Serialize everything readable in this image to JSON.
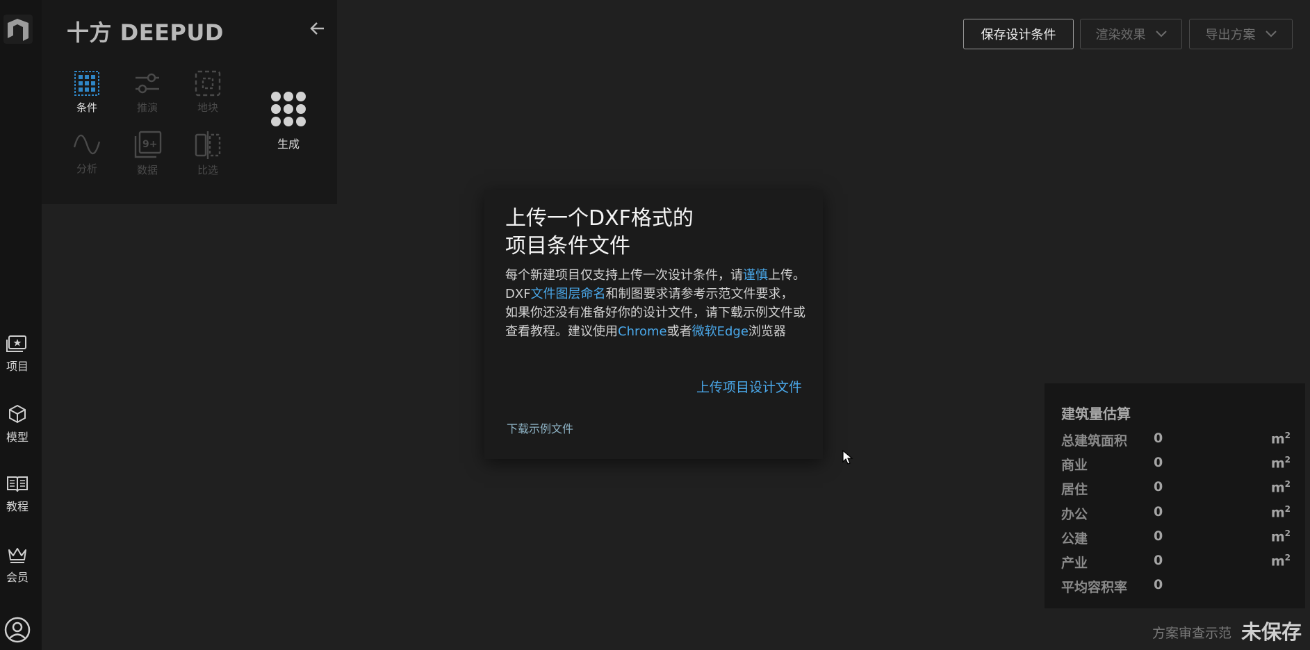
{
  "app": {
    "brand": "十方 DEEPUD"
  },
  "rail": {
    "items": [
      {
        "label": "项目",
        "icon": "project-star-icon"
      },
      {
        "label": "模型",
        "icon": "cube-icon"
      },
      {
        "label": "教程",
        "icon": "book-icon"
      },
      {
        "label": "会员",
        "icon": "crown-icon"
      }
    ]
  },
  "tools": [
    {
      "label": "条件",
      "icon": "grid-icon",
      "state": "active"
    },
    {
      "label": "推演",
      "icon": "sliders-icon",
      "state": "disabled"
    },
    {
      "label": "地块",
      "icon": "dashed-square-icon",
      "state": "disabled"
    },
    {
      "label": "分析",
      "icon": "wave-icon",
      "state": "disabled"
    },
    {
      "label": "数据",
      "icon": "data-9plus-icon",
      "state": "disabled"
    },
    {
      "label": "比选",
      "icon": "compare-icon",
      "state": "disabled"
    }
  ],
  "generate": {
    "label": "生成",
    "icon": "dots-grid-icon"
  },
  "toolbar": {
    "save": "保存设计条件",
    "render": "渲染效果",
    "export": "导出方案"
  },
  "dialog": {
    "title_line1": "上传一个DXF格式的",
    "title_line2": "项目条件文件",
    "body": {
      "p1_a": "每个新建项目仅支持上传一次设计条件，请",
      "p1_link": "谨慎",
      "p1_b": "上传。",
      "p2_a": "DXF",
      "p2_link": "文件图层命名",
      "p2_b": "和制图要求请参考示范文件要求，",
      "p3": "如果你还没有准备好你的设计文件，请下载示例文件或",
      "p4_a": "查看教程。建议使用",
      "p4_link1": "Chrome",
      "p4_b": "或者",
      "p4_link2": "微软Edge",
      "p4_c": "浏览器"
    },
    "upload": "上传项目设计文件",
    "download": "下载示例文件"
  },
  "estimate": {
    "title": "建筑量估算",
    "rows": [
      {
        "key": "总建筑面积",
        "value": "0",
        "unit": "m",
        "exp": "2"
      },
      {
        "key": "商业",
        "value": "0",
        "unit": "m",
        "exp": "2"
      },
      {
        "key": "居住",
        "value": "0",
        "unit": "m",
        "exp": "2"
      },
      {
        "key": "办公",
        "value": "0",
        "unit": "m",
        "exp": "2"
      },
      {
        "key": "公建",
        "value": "0",
        "unit": "m",
        "exp": "2"
      },
      {
        "key": "产业",
        "value": "0",
        "unit": "m",
        "exp": "2"
      },
      {
        "key": "平均容积率",
        "value": "0",
        "unit": "",
        "exp": ""
      }
    ]
  },
  "footer": {
    "note": "方案审查示范",
    "status": "未保存"
  },
  "colors": {
    "accent": "#4aa8ea",
    "background": "#202020",
    "panel": "#181818"
  }
}
